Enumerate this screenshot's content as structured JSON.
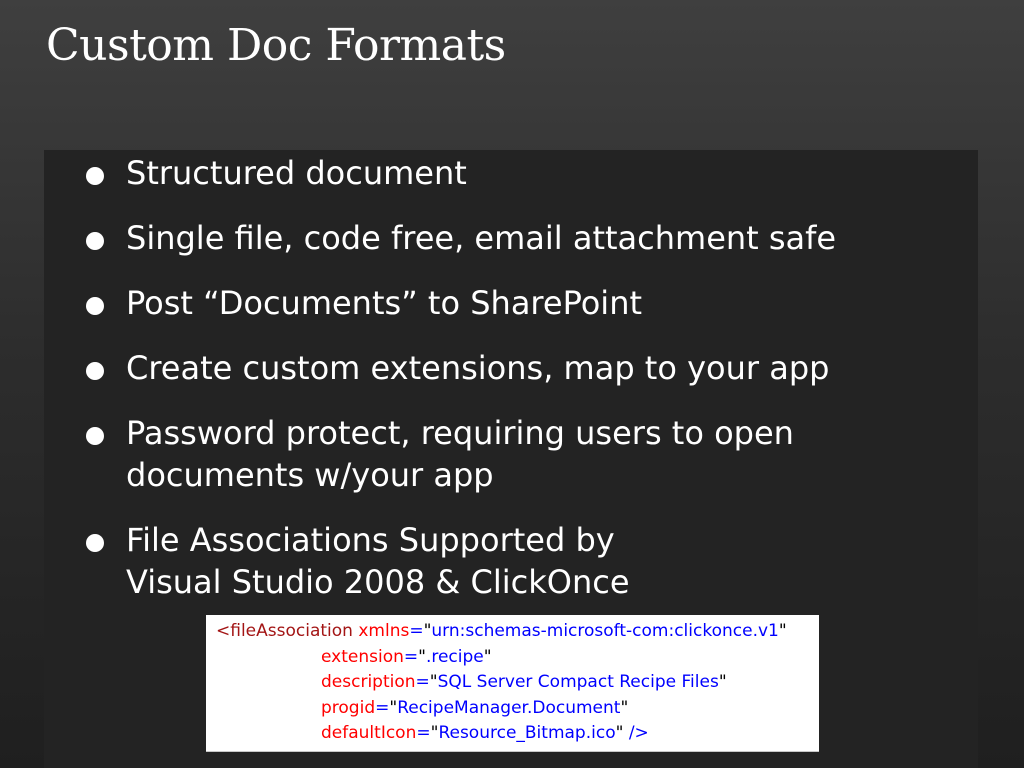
{
  "slide": {
    "title": "Custom Doc Formats"
  },
  "bullets": [
    {
      "lines": [
        "Structured document"
      ]
    },
    {
      "lines": [
        "Single file, code free, email attachment safe"
      ]
    },
    {
      "lines": [
        "Post “Documents” to SharePoint"
      ]
    },
    {
      "lines": [
        "Create custom extensions, map to your app"
      ]
    },
    {
      "lines": [
        "Password protect, requiring users to open",
        "documents w/your app"
      ]
    },
    {
      "lines": [
        "File Associations Supported by",
        "Visual Studio 2008 & ClickOnce"
      ]
    }
  ],
  "code_sample": {
    "tag_open": "<fileAssociation",
    "attributes": [
      {
        "name": "xmlns",
        "value": "urn:schemas-microsoft-com:clickonce.v1"
      },
      {
        "name": "extension",
        "value": ".recipe"
      },
      {
        "name": "description",
        "value": "SQL Server Compact Recipe Files"
      },
      {
        "name": "progid",
        "value": "RecipeManager.Document"
      },
      {
        "name": "defaultIcon",
        "value": "Resource_Bitmap.ico"
      }
    ],
    "tag_close": "/>"
  },
  "colors": {
    "background": "#2d2d2d",
    "panel": "#232323",
    "text": "#ffffff",
    "xml_tag": "#a31515",
    "xml_attribute": "#ff0000",
    "xml_value": "#0000ff"
  }
}
